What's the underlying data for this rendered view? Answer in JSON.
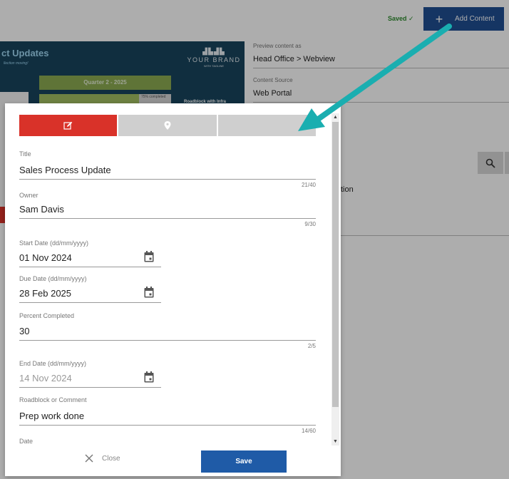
{
  "header": {
    "saved_label": "Saved",
    "add_content_label": "Add Content"
  },
  "banner": {
    "title": "ct Updates",
    "subtitle": "llection moving!",
    "brand_name": "YOUR BRAND",
    "brand_tag": "WITH TAGLINE",
    "quarter": "Quarter 2 - 2025",
    "percent_mini": "75% completed",
    "roadblock_mini": "Roadblock with Infra"
  },
  "preview": {
    "label": "Preview content as",
    "value": "Head Office > Webview",
    "source_label": "Content Source",
    "source_value": "Web Portal",
    "partial_text": "tion"
  },
  "modal": {
    "tabs": [
      {
        "icon": "edit-icon",
        "active": true
      },
      {
        "icon": "location-pin-icon",
        "active": false
      },
      {
        "icon": "",
        "active": false
      }
    ],
    "fields": {
      "title": {
        "label": "Title",
        "value": "Sales Process Update",
        "count": "21/40"
      },
      "owner": {
        "label": "Owner",
        "value": "Sam Davis",
        "count": "9/30"
      },
      "start_date": {
        "label": "Start Date (dd/mm/yyyy)",
        "value": "01 Nov 2024"
      },
      "due_date": {
        "label": "Due Date (dd/mm/yyyy)",
        "value": "28 Feb 2025"
      },
      "percent": {
        "label": "Percent Completed",
        "value": "30",
        "count": "2/5"
      },
      "end_date": {
        "label": "End Date (dd/mm/yyyy)",
        "value": "14 Nov 2024"
      },
      "roadblock": {
        "label": "Roadblock or Comment",
        "value": "Prep work done",
        "count": "14/60"
      },
      "date": {
        "label": "Date"
      }
    },
    "close_label": "Close",
    "save_label": "Save"
  },
  "colors": {
    "accent_blue": "#1f5ba7",
    "active_tab_red": "#d93229",
    "arrow_teal": "#1aaeb0",
    "saved_green": "#2e8b2e"
  }
}
